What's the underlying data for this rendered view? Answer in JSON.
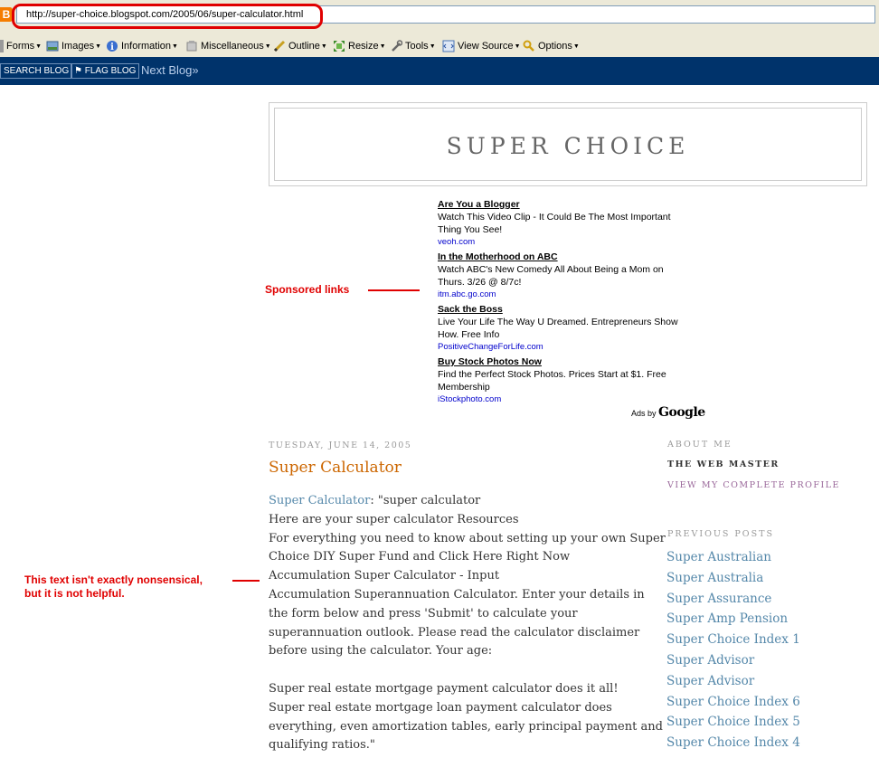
{
  "browser": {
    "url": "http://super-choice.blogspot.com/2005/06/super-calculator.html",
    "favicon_letter": "B",
    "toolbar": [
      {
        "label": "Forms",
        "icon": "forms-icon"
      },
      {
        "label": "Images",
        "icon": "images-icon"
      },
      {
        "label": "Information",
        "icon": "information-icon"
      },
      {
        "label": "Miscellaneous",
        "icon": "miscellaneous-icon"
      },
      {
        "label": "Outline",
        "icon": "outline-icon"
      },
      {
        "label": "Resize",
        "icon": "resize-icon"
      },
      {
        "label": "Tools",
        "icon": "tools-icon"
      },
      {
        "label": "View Source",
        "icon": "view-source-icon"
      },
      {
        "label": "Options",
        "icon": "options-icon"
      }
    ]
  },
  "navbar": {
    "search_blog": "SEARCH BLOG",
    "flag_blog": "FLAG BLOG",
    "next_blog": "Next Blog»"
  },
  "blog": {
    "title": "SUPER CHOICE"
  },
  "ads": [
    {
      "title": "Are You a Blogger",
      "text": [
        "Watch This Video Clip - It Could Be The Most Important",
        "Thing You See!"
      ],
      "url": "veoh.com"
    },
    {
      "title": "In the Motherhood on ABC",
      "text": [
        "Watch ABC's New Comedy All About Being a Mom on",
        "Thurs. 3/26 @ 8/7c!"
      ],
      "url": "itm.abc.go.com"
    },
    {
      "title": "Sack the Boss",
      "text": [
        "Live Your Life The Way U Dreamed. Entrepreneurs Show",
        "How. Free Info"
      ],
      "url": "PositiveChangeForLife.com"
    },
    {
      "title": "Buy Stock Photos Now",
      "text": [
        "Find the Perfect Stock Photos. Prices Start at $1. Free",
        "Membership"
      ],
      "url": "iStockphoto.com"
    }
  ],
  "ads_by": {
    "prefix": "Ads by",
    "brand": "Google"
  },
  "annotations": {
    "sponsored": "Sponsored links",
    "nonsense_1": "This text isn't exactly nonsensical,",
    "nonsense_2": "but it is not helpful."
  },
  "post": {
    "date": "TUESDAY, JUNE 14, 2005",
    "title": "Super Calculator",
    "link": "Super Calculator",
    "first_rest": ": \"super calculator",
    "lines": [
      "Here are your super calculator Resources",
      "For everything you need to know about setting up your own Super",
      "Choice DIY Super Fund and Click Here Right Now",
      "Accumulation Super Calculator - Input",
      "Accumulation Superannuation Calculator. Enter your details in",
      "the form below and press 'Submit' to calculate your",
      "superannuation outlook. Please read the calculator disclaimer",
      "before using the calculator. Your age:",
      "",
      "Super real estate mortgage payment calculator does it all!",
      "Super real estate mortgage loan payment calculator does",
      "everything, even amortization tables, early principal payment and",
      "qualifying ratios.\""
    ]
  },
  "sidebar": {
    "about_heading": "ABOUT ME",
    "name": "THE WEB MASTER",
    "profile_link": "VIEW MY COMPLETE PROFILE",
    "previous_heading": "PREVIOUS POSTS",
    "previous_posts": [
      "Super Australian",
      "Super Australia",
      "Super Assurance",
      "Super Amp Pension",
      "Super Choice Index 1",
      "Super Advisor",
      "Super Advisor",
      "Super Choice Index 6",
      "Super Choice Index 5",
      "Super Choice Index 4"
    ]
  },
  "colors": {
    "navbar": "#00336b",
    "annotation": "#e00000",
    "post_title": "#cc6600",
    "link": "#5588aa",
    "ad_url": "#0000cc"
  }
}
